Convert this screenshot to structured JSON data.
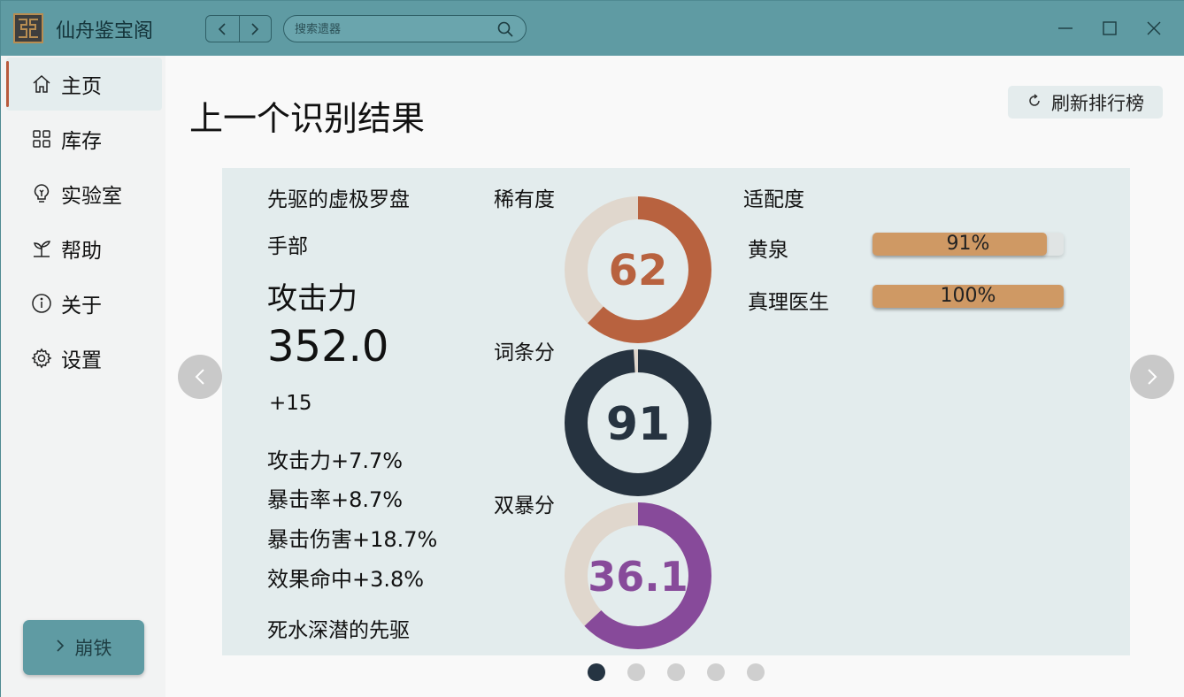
{
  "app": {
    "title": "仙舟鉴宝阁",
    "search_placeholder": "搜索遗器"
  },
  "sidebar": {
    "items": [
      {
        "label": "主页",
        "icon": "home-icon",
        "active": true
      },
      {
        "label": "库存",
        "icon": "grid-icon",
        "active": false
      },
      {
        "label": "实验室",
        "icon": "lightbulb-icon",
        "active": false
      },
      {
        "label": "帮助",
        "icon": "sprout-icon",
        "active": false
      },
      {
        "label": "关于",
        "icon": "info-icon",
        "active": false
      },
      {
        "label": "设置",
        "icon": "gear-icon",
        "active": false
      }
    ],
    "game_button": "崩铁"
  },
  "main": {
    "title": "上一个识别结果",
    "refresh_label": "刷新排行榜"
  },
  "relic": {
    "name": "先驱的虚极罗盘",
    "slot": "手部",
    "main_stat": "攻击力",
    "main_value": "352.0",
    "level": "+15",
    "substats": [
      "攻击力+7.7%",
      "暴击率+8.7%",
      "暴击伤害+18.7%",
      "效果命中+3.8%"
    ],
    "set_name": "死水深潜的先驱"
  },
  "scores": {
    "rarity": {
      "label": "稀有度",
      "value": "62",
      "fraction": 0.62,
      "color": "#b8623f"
    },
    "substat": {
      "label": "词条分",
      "value": "91",
      "fraction": 0.99,
      "color": "#263340"
    },
    "crit": {
      "label": "双暴分",
      "value": "36.1",
      "fraction": 0.63,
      "color": "#874a9a"
    }
  },
  "fit": {
    "label": "适配度",
    "characters": [
      {
        "name": "黄泉",
        "value": "91%",
        "fraction": 0.91
      },
      {
        "name": "真理医生",
        "value": "100%",
        "fraction": 1.0
      }
    ]
  },
  "carousel": {
    "pages": 5,
    "active": 0
  }
}
